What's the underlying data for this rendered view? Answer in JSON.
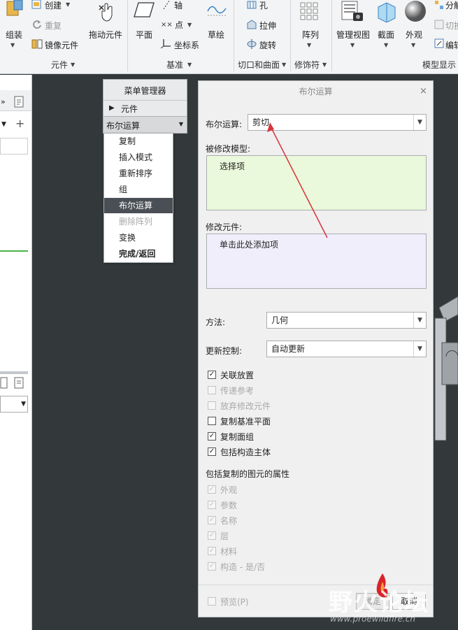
{
  "ribbon": {
    "groups": {
      "yuanjian": "元件",
      "jizhun": "基准",
      "qiekou": "切口和曲面",
      "xiushifu": "修饰符",
      "moxingxianshi": "模型显示"
    },
    "buttons": {
      "zuzhuang": "组装",
      "chuangjian": "创建",
      "chongfu": "重复",
      "jingxiang": "镜像元件",
      "tuodong": "拖动元件",
      "pingmian": "平面",
      "zhou": "轴",
      "dian": "点",
      "zuobiaoxi": "坐标系",
      "caohui": "草绘",
      "kong": "孔",
      "lashen": "拉伸",
      "xuanzhuan": "旋转",
      "zhenlie": "阵列",
      "guanlishitu": "管理视图",
      "jiemian": "截面",
      "waiguan": "外观",
      "fenjie": "分解",
      "qiehuan": "切换",
      "bianji": "编辑"
    }
  },
  "menu_manager": {
    "title": "菜单管理器",
    "component_item": "元件",
    "boolean_dropdown": "布尔运算",
    "items": [
      "复制",
      "插入模式",
      "重新排序",
      "组",
      "布尔运算",
      "删除阵列",
      "变换",
      "完成/返回"
    ]
  },
  "dialog": {
    "title": "布尔运算",
    "boolean_label": "布尔运算:",
    "boolean_value": "剪切",
    "modified_model_label": "被修改模型:",
    "modified_model_value": "选择项",
    "modifying_components_label": "修改元件:",
    "modifying_components_value": "单击此处添加项",
    "method_label": "方法:",
    "method_value": "几何",
    "update_label": "更新控制:",
    "update_value": "自动更新",
    "options": [
      {
        "label": "关联放置",
        "checked": true,
        "enabled": true
      },
      {
        "label": "传递参考",
        "checked": false,
        "enabled": false
      },
      {
        "label": "放弃修改元件",
        "checked": false,
        "enabled": false
      },
      {
        "label": "复制基准平面",
        "checked": false,
        "enabled": true
      },
      {
        "label": "复制面组",
        "checked": true,
        "enabled": true
      },
      {
        "label": "包括构造主体",
        "checked": true,
        "enabled": true
      }
    ],
    "attributes_label": "包括复制的图元的属性",
    "attributes": [
      {
        "label": "外观",
        "checked": true
      },
      {
        "label": "参数",
        "checked": true
      },
      {
        "label": "名称",
        "checked": true
      },
      {
        "label": "层",
        "checked": true
      },
      {
        "label": "材料",
        "checked": true
      },
      {
        "label": "构造 - 是/否",
        "checked": true
      }
    ],
    "preview_label": "预览(P)",
    "ok_label": "确定",
    "cancel_label": "取消"
  },
  "watermark": {
    "brand": "野火论坛",
    "url": "www.proewildfire.cn"
  },
  "colors": {
    "modified_model_bg": "#eaf8db",
    "modifying_components_bg": "#f1eefc",
    "annotation_arrow": "#d8343b",
    "viewport_bg": "#33393a"
  }
}
